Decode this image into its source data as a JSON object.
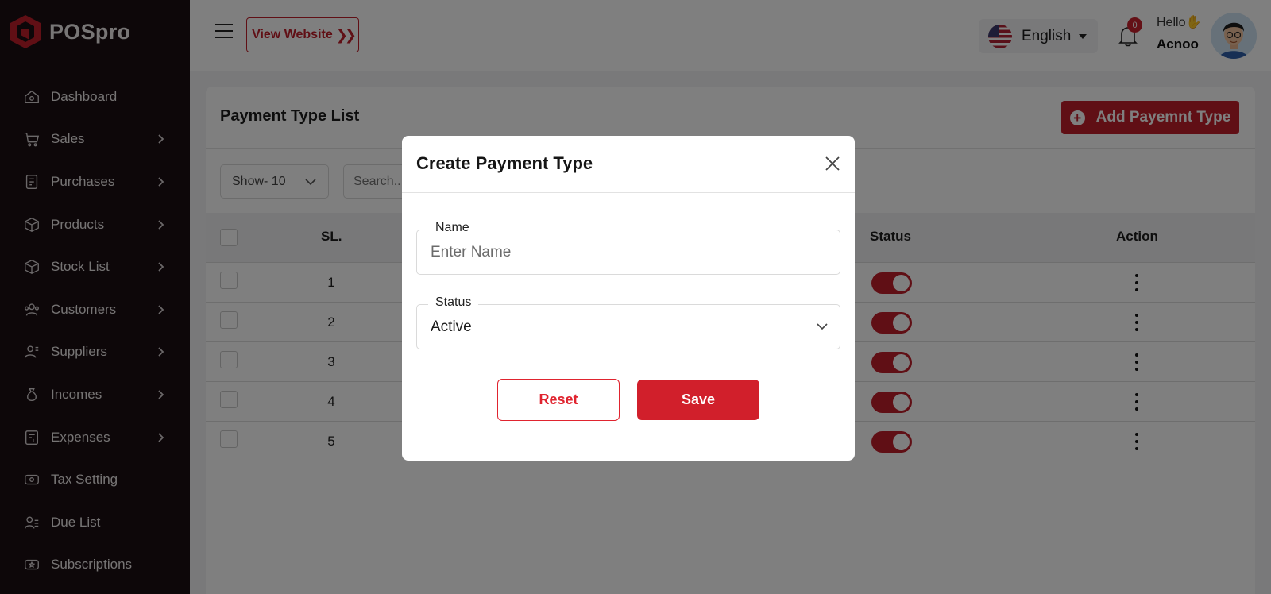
{
  "brand": {
    "name": "POSpro",
    "accent": "#c11f2a"
  },
  "sidebar": {
    "items": [
      {
        "label": "Dashboard",
        "icon": "home-icon",
        "has_chevron": false
      },
      {
        "label": "Sales",
        "icon": "cart-icon",
        "has_chevron": true
      },
      {
        "label": "Purchases",
        "icon": "receipt-icon",
        "has_chevron": true
      },
      {
        "label": "Products",
        "icon": "box-icon",
        "has_chevron": true
      },
      {
        "label": "Stock List",
        "icon": "stock-icon",
        "has_chevron": true
      },
      {
        "label": "Customers",
        "icon": "users-icon",
        "has_chevron": true
      },
      {
        "label": "Suppliers",
        "icon": "supplier-icon",
        "has_chevron": true
      },
      {
        "label": "Incomes",
        "icon": "money-bag-icon",
        "has_chevron": true
      },
      {
        "label": "Expenses",
        "icon": "expense-icon",
        "has_chevron": true
      },
      {
        "label": "Tax Setting",
        "icon": "tax-icon",
        "has_chevron": false
      },
      {
        "label": "Due List",
        "icon": "due-list-icon",
        "has_chevron": false
      },
      {
        "label": "Subscriptions",
        "icon": "subscription-icon",
        "has_chevron": false
      }
    ]
  },
  "topbar": {
    "view_website": "View Website",
    "language": "English",
    "notification_count": "0",
    "greeting": "Hello",
    "user_name": "Acnoo"
  },
  "page": {
    "title": "Payment Type List",
    "add_button": "Add Payemnt Type",
    "show_select": "Show- 10",
    "search_placeholder": "Search...",
    "columns": {
      "sl": "SL.",
      "status": "Status",
      "action": "Action"
    },
    "rows": [
      {
        "sl": "1",
        "status_active": true
      },
      {
        "sl": "2",
        "status_active": true
      },
      {
        "sl": "3",
        "status_active": true
      },
      {
        "sl": "4",
        "status_active": true
      },
      {
        "sl": "5",
        "status_active": true
      }
    ]
  },
  "modal": {
    "title": "Create Payment Type",
    "name_label": "Name",
    "name_placeholder": "Enter Name",
    "status_label": "Status",
    "status_value": "Active",
    "reset_label": "Reset",
    "save_label": "Save"
  }
}
